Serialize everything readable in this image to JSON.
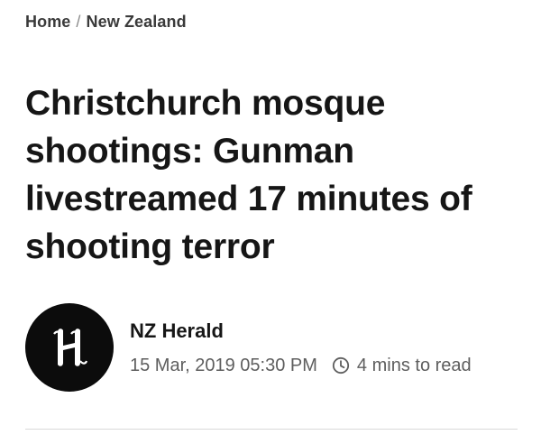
{
  "breadcrumb": {
    "home": "Home",
    "separator": "/",
    "section": "New Zealand"
  },
  "article": {
    "headline": "Christchurch mosque shootings: Gunman livestreamed 17 minutes of shooting terror"
  },
  "byline": {
    "author": "NZ Herald",
    "published": "15 Mar, 2019 05:30 PM",
    "read_time": "4 mins to read",
    "avatar_icon": "nz-herald-h-logo",
    "clock_icon": "clock-icon"
  },
  "colors": {
    "text": "#161616",
    "muted": "#5e5e5e",
    "avatar_bg": "#0c0c0c",
    "divider": "#d9d9d9"
  }
}
